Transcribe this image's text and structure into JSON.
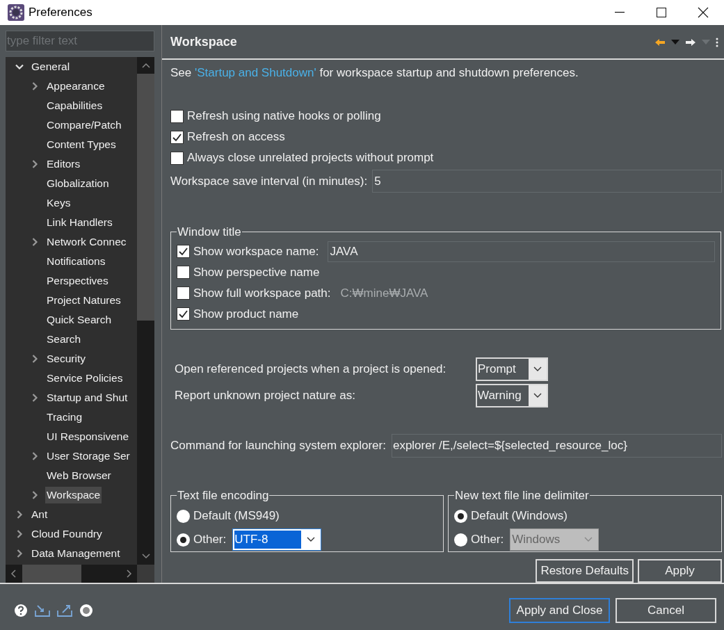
{
  "window": {
    "title": "Preferences"
  },
  "filter": {
    "placeholder": "type filter text"
  },
  "tree": [
    {
      "label": "General",
      "kind": "branch",
      "expanded": true,
      "selected": false,
      "children": [
        {
          "label": "Appearance",
          "kind": "branch",
          "expanded": false,
          "selected": false
        },
        {
          "label": "Capabilities",
          "kind": "leaf",
          "selected": false
        },
        {
          "label": "Compare/Patch",
          "kind": "leaf",
          "selected": false
        },
        {
          "label": "Content Types",
          "kind": "leaf",
          "selected": false
        },
        {
          "label": "Editors",
          "kind": "branch",
          "expanded": false,
          "selected": false
        },
        {
          "label": "Globalization",
          "kind": "leaf",
          "selected": false
        },
        {
          "label": "Keys",
          "kind": "leaf",
          "selected": false
        },
        {
          "label": "Link Handlers",
          "kind": "leaf",
          "selected": false
        },
        {
          "label": "Network Connec",
          "kind": "branch",
          "expanded": false,
          "selected": false
        },
        {
          "label": "Notifications",
          "kind": "leaf",
          "selected": false
        },
        {
          "label": "Perspectives",
          "kind": "leaf",
          "selected": false
        },
        {
          "label": "Project Natures",
          "kind": "leaf",
          "selected": false
        },
        {
          "label": "Quick Search",
          "kind": "leaf",
          "selected": false
        },
        {
          "label": "Search",
          "kind": "leaf",
          "selected": false
        },
        {
          "label": "Security",
          "kind": "branch",
          "expanded": false,
          "selected": false
        },
        {
          "label": "Service Policies",
          "kind": "leaf",
          "selected": false
        },
        {
          "label": "Startup and Shut",
          "kind": "branch",
          "expanded": false,
          "selected": false
        },
        {
          "label": "Tracing",
          "kind": "leaf",
          "selected": false
        },
        {
          "label": "UI Responsivene",
          "kind": "leaf",
          "selected": false
        },
        {
          "label": "User Storage Ser",
          "kind": "branch",
          "expanded": false,
          "selected": false
        },
        {
          "label": "Web Browser",
          "kind": "leaf",
          "selected": false
        },
        {
          "label": "Workspace",
          "kind": "branch",
          "expanded": false,
          "selected": true
        }
      ]
    },
    {
      "label": "Ant",
      "kind": "branch",
      "expanded": false,
      "selected": false
    },
    {
      "label": "Cloud Foundry",
      "kind": "branch",
      "expanded": false,
      "selected": false
    },
    {
      "label": "Data Management",
      "kind": "branch",
      "expanded": false,
      "selected": false
    }
  ],
  "page": {
    "title": "Workspace",
    "intro": {
      "before": "See ",
      "link": "'Startup and Shutdown'",
      "after": " for workspace startup and shutdown preferences."
    },
    "options": [
      {
        "label": "Refresh using native hooks or polling",
        "checked": false
      },
      {
        "label": "Refresh on access",
        "checked": true
      },
      {
        "label": "Always close unrelated projects without prompt",
        "checked": false
      }
    ],
    "save_interval": {
      "label": "Workspace save interval (in minutes):",
      "value": "5"
    },
    "window_title": {
      "title": "Window title",
      "rows": [
        {
          "kind": "field",
          "label": "Show workspace name:",
          "checked": true,
          "value": "JAVA"
        },
        {
          "kind": "plain",
          "label": "Show perspective name",
          "checked": false
        },
        {
          "kind": "path",
          "label": "Show full workspace path:",
          "checked": false,
          "value": "C:₩mine₩JAVA"
        },
        {
          "kind": "plain",
          "label": "Show product name",
          "checked": true
        }
      ]
    },
    "selects": [
      {
        "label": "Open referenced projects when a project is opened:",
        "value": "Prompt"
      },
      {
        "label": "Report unknown project nature as:",
        "value": "Warning"
      }
    ],
    "explorer": {
      "label": "Command for launching system explorer:",
      "value": "explorer /E,/select=${selected_resource_loc}"
    },
    "groups": [
      {
        "title": "Text file encoding",
        "options": [
          {
            "label": "Default (MS949)",
            "selected": false
          },
          {
            "label": "Other:",
            "selected": true
          }
        ],
        "combo": {
          "value": "UTF-8",
          "disabled": false,
          "text_selected": true
        }
      },
      {
        "title": "New text file line delimiter",
        "options": [
          {
            "label": "Default (Windows)",
            "selected": true
          },
          {
            "label": "Other:",
            "selected": false
          }
        ],
        "combo": {
          "value": "Windows",
          "disabled": true,
          "text_selected": false
        }
      }
    ],
    "buttons": [
      "Restore Defaults",
      "Apply"
    ]
  },
  "footer_buttons": [
    {
      "label": "Apply and Close",
      "default": true
    },
    {
      "label": "Cancel",
      "default": false
    }
  ]
}
